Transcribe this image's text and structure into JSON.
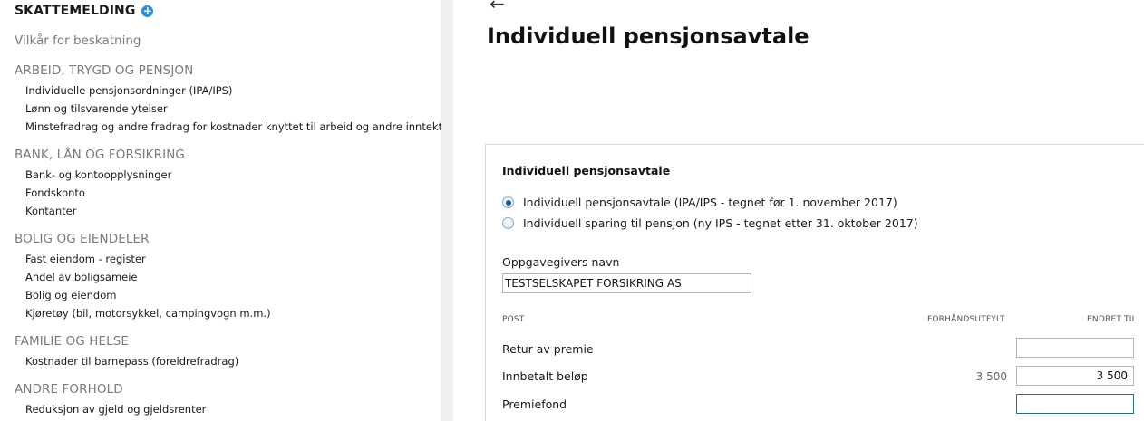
{
  "sidebar": {
    "title": "SKATTEMELDING",
    "vilkar": "Vilkår for beskatning",
    "sections": [
      {
        "heading": "ARBEID, TRYGD OG PENSJON",
        "items": [
          "Individuelle pensjonsordninger (IPA/IPS)",
          "Lønn og tilsvarende ytelser",
          "Minstefradrag og andre fradrag for kostnader knyttet til arbeid og andre inntekter"
        ]
      },
      {
        "heading": "BANK, LÅN OG FORSIKRING",
        "items": [
          "Bank- og kontoopplysninger",
          "Fondskonto",
          "Kontanter"
        ]
      },
      {
        "heading": "BOLIG OG EIENDELER",
        "items": [
          "Fast eiendom - register",
          "Andel av boligsameie",
          "Bolig og eiendom",
          "Kjøretøy (bil, motorsykkel, campingvogn m.m.)"
        ]
      },
      {
        "heading": "FAMILIE OG HELSE",
        "items": [
          "Kostnader til barnepass (foreldrefradrag)"
        ]
      },
      {
        "heading": "ANDRE FORHOLD",
        "items": [
          "Reduksjon av gjeld og gjeldsrenter"
        ]
      }
    ]
  },
  "main": {
    "back_arrow": "←",
    "title": "Individuell pensjonsavtale",
    "card": {
      "title": "Individuell pensjonsavtale",
      "radios": [
        {
          "label": "Individuell pensjonsavtale (IPA/IPS - tegnet før 1. november 2017)",
          "checked": true
        },
        {
          "label": "Individuell sparing til pensjon (ny IPS - tegnet etter 31. oktober 2017)",
          "checked": false
        }
      ],
      "oppgavegiver_label": "Oppgavegivers navn",
      "oppgavegiver_value": "TESTSELSKAPET FORSIKRING AS",
      "columns": {
        "post": "POST",
        "prefilled": "FORHÅNDSUTFYLT",
        "changed": "ENDRET TIL"
      },
      "rows": [
        {
          "label": "Retur av premie",
          "prefilled": "",
          "changed": ""
        },
        {
          "label": "Innbetalt beløp",
          "prefilled": "3 500",
          "changed": "3 500"
        },
        {
          "label": "Premiefond",
          "prefilled": "",
          "changed": ""
        }
      ]
    }
  }
}
